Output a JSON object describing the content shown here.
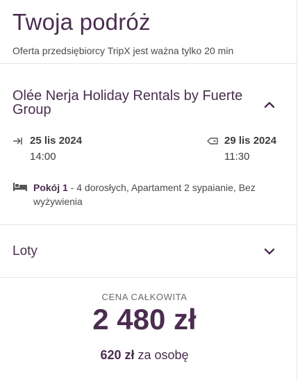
{
  "header": {
    "title": "Twoja podróż",
    "subtitle": "Oferta przedsiębiorcy TripX jest ważna tylko 20 min"
  },
  "hotel": {
    "name": "Olée Nerja Holiday Rentals by Fuerte Group",
    "checkin_date": "25 lis 2024",
    "checkin_time": "14:00",
    "checkout_date": "29 lis 2024",
    "checkout_time": "11:30",
    "room_label": "Pokój 1",
    "room_details": " - 4 dorosłych, Apartament 2 sypaianie, Bez wyżywienia"
  },
  "flights": {
    "label": "Loty"
  },
  "price": {
    "label": "CENA CAŁKOWITA",
    "total": "2 480 zł",
    "per_person_amount": "620 zł",
    "per_person_suffix": "za osobę"
  },
  "colors": {
    "accent": "#4a2d4f",
    "divider": "#e6e6e6"
  },
  "icons": {
    "expand_hotel": "chevron-up-icon",
    "expand_flights": "chevron-down-icon",
    "checkin": "checkin-arrow-icon",
    "checkout": "checkout-arrow-icon",
    "room": "bed-icon"
  }
}
